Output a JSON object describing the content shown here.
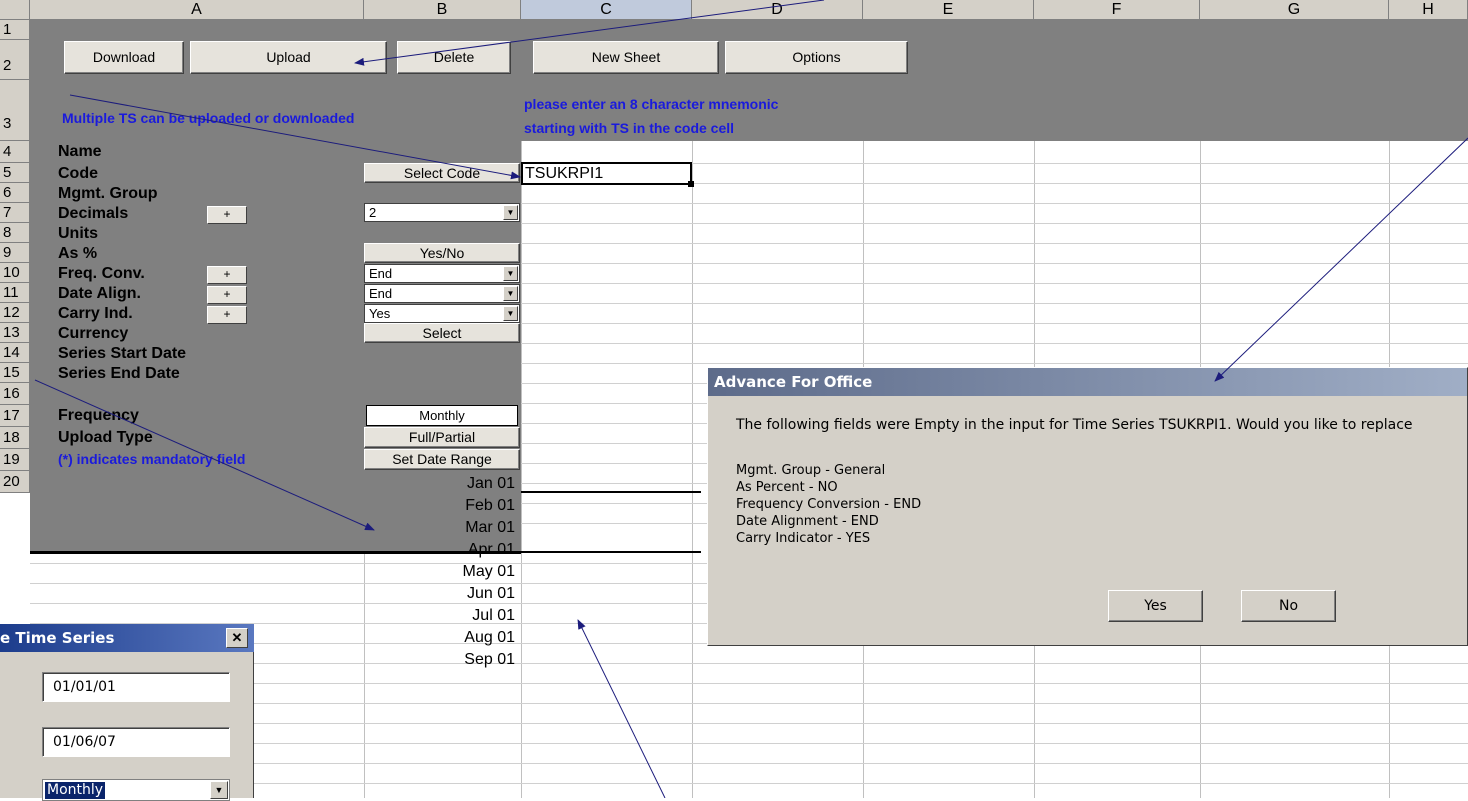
{
  "columns": [
    "A",
    "B",
    "C",
    "D",
    "E",
    "F",
    "G",
    "H"
  ],
  "rows": [
    "1",
    "2",
    "3",
    "4",
    "5",
    "6",
    "7",
    "8",
    "9",
    "10",
    "11",
    "12",
    "13",
    "14",
    "15",
    "16",
    "17",
    "18",
    "19",
    "20"
  ],
  "toolbar": {
    "download": "Download",
    "upload": "Upload",
    "delete": "Delete",
    "new_sheet": "New Sheet",
    "options": "Options"
  },
  "notes": {
    "multi": "Multiple TS can be uploaded or downloaded",
    "mnemonic_1": "please enter an 8 character mnemonic",
    "mnemonic_2": "starting with TS in the code cell",
    "mandatory": "(*) indicates mandatory field"
  },
  "labels": {
    "name": "Name",
    "code": "Code",
    "mgmt": "Mgmt. Group",
    "decimals": "Decimals",
    "units": "Units",
    "as_pct": "As %",
    "freq_conv": "Freq. Conv.",
    "date_align": "Date Align.",
    "carry": "Carry Ind.",
    "currency": "Currency",
    "start": "Series Start Date",
    "end": "Series End Date",
    "frequency": "Frequency",
    "upload_type": "Upload Type"
  },
  "plus": "+",
  "controls": {
    "select_code": "Select Code",
    "code_value": "TSUKRPI1",
    "decimals_value": "2",
    "yes_no": "Yes/No",
    "freq_conv_value": "End",
    "date_align_value": "End",
    "carry_value": "Yes",
    "select": "Select",
    "frequency_value": "Monthly",
    "full_partial": "Full/Partial",
    "set_date_range": "Set Date Range"
  },
  "dates": [
    "Jan 01",
    "Feb 01",
    "Mar 01",
    "Apr 01",
    "May 01",
    "Jun 01",
    "Jul 01",
    "Aug 01",
    "Sep 01"
  ],
  "dialog": {
    "title": "Advance For Office",
    "message": "The following fields were Empty in the input for Time Series TSUKRPI1. Would you like to replace",
    "lines": [
      "Mgmt. Group - General",
      "As Percent - NO",
      "Frequency Conversion - END",
      "Date Alignment - END",
      "Carry Indicator - YES"
    ],
    "yes": "Yes",
    "no": "No"
  },
  "ts_dialog": {
    "title": "e Time Series",
    "close": "✕",
    "start": "01/01/01",
    "end": "01/06/07",
    "frequency": "Monthly"
  },
  "colors": {
    "header_gray": "#d4d0c8",
    "panel_gray": "#808080",
    "note_blue": "#1a1adc",
    "arrow": "#1c1c7c"
  }
}
